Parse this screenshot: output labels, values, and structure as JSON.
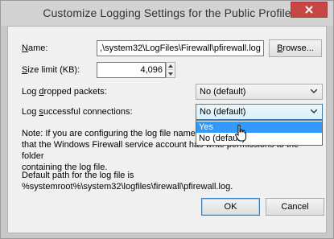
{
  "window": {
    "title": "Customize Logging Settings for the Public Profile"
  },
  "name_field": {
    "label_prefix": "",
    "label_accel": "N",
    "label_rest": "ame:",
    "value": ",\\system32\\LogFiles\\Firewall\\pfirewall.log",
    "browse_prefix": "",
    "browse_accel": "B",
    "browse_rest": "rowse..."
  },
  "size_limit": {
    "label_accel": "S",
    "label_rest": "ize limit (KB):",
    "value": "4,096"
  },
  "log_dropped": {
    "label_prefix": "Log ",
    "label_accel": "d",
    "label_rest": "ropped packets:",
    "value": "No (default)"
  },
  "log_successful": {
    "label_prefix": "Log ",
    "label_accel": "s",
    "label_rest": "uccessful connections:",
    "value": "No (default)",
    "options": [
      "Yes",
      "No (default)"
    ],
    "highlighted_option": "Yes"
  },
  "note": {
    "line1": "Note: If you are configuring the log file name o",
    "line2": "that the Windows Firewall service account has write permissions to the folder",
    "line3": "containing the log file."
  },
  "default_path": {
    "line1": "Default path for the log file is",
    "line2": "%systemroot%\\system32\\logfiles\\firewall\\pfirewall.log."
  },
  "buttons": {
    "ok": "OK",
    "cancel": "Cancel"
  },
  "colors": {
    "close_button": "#c74545",
    "selection": "#3399ff",
    "focus_border": "#3c7fb1"
  }
}
